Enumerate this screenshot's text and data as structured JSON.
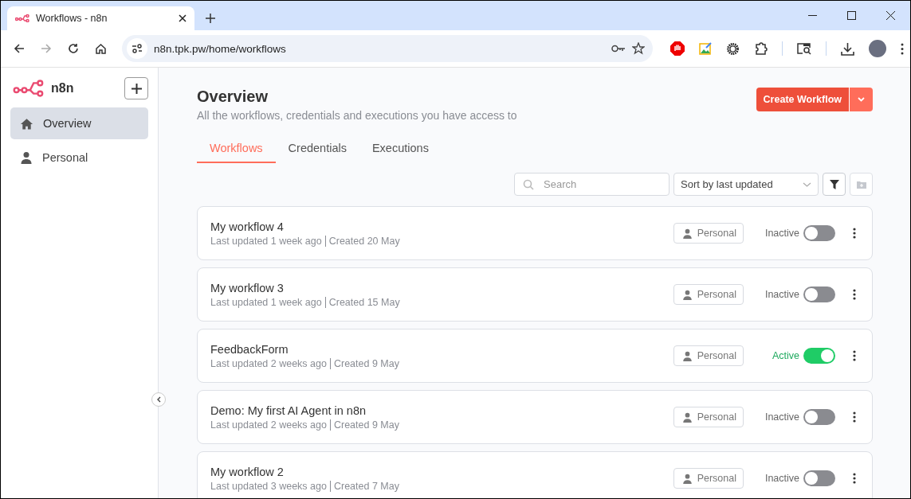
{
  "browser": {
    "tab_title": "Workflows - n8n",
    "url": "n8n.tpk.pw/home/workflows"
  },
  "sidebar": {
    "brand": "n8n",
    "items": [
      {
        "label": "Overview",
        "kind": "home",
        "selected": true
      },
      {
        "label": "Personal",
        "kind": "user",
        "selected": false
      }
    ]
  },
  "header": {
    "title": "Overview",
    "subtitle": "All the workflows, credentials and executions you have access to",
    "create_button": "Create Workflow"
  },
  "tabs": [
    {
      "label": "Workflows",
      "selected": true
    },
    {
      "label": "Credentials",
      "selected": false
    },
    {
      "label": "Executions",
      "selected": false
    }
  ],
  "search": {
    "placeholder": "Search"
  },
  "sort": {
    "value": "Sort by last updated"
  },
  "workflows": [
    {
      "name": "My workflow 4",
      "updated": "Last updated 1 week ago",
      "created": "Created 20 May",
      "owner": "Personal",
      "status_label": "Inactive",
      "active": false
    },
    {
      "name": "My workflow 3",
      "updated": "Last updated 1 week ago",
      "created": "Created 15 May",
      "owner": "Personal",
      "status_label": "Inactive",
      "active": false
    },
    {
      "name": "FeedbackForm",
      "updated": "Last updated 2 weeks ago",
      "created": "Created 9 May",
      "owner": "Personal",
      "status_label": "Active",
      "active": true
    },
    {
      "name": "Demo: My first AI Agent in n8n",
      "updated": "Last updated 2 weeks ago",
      "created": "Created 9 May",
      "owner": "Personal",
      "status_label": "Inactive",
      "active": false
    },
    {
      "name": "My workflow 2",
      "updated": "Last updated 3 weeks ago",
      "created": "Created 7 May",
      "owner": "Personal",
      "status_label": "Inactive",
      "active": false
    }
  ]
}
